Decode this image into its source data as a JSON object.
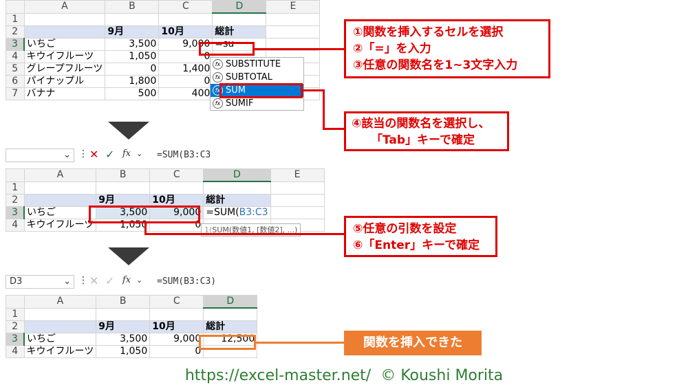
{
  "columns": [
    "A",
    "B",
    "C",
    "D",
    "E"
  ],
  "top_sheet": {
    "rows": [
      "1",
      "2",
      "3",
      "4",
      "5",
      "6",
      "7"
    ],
    "header_row": [
      "",
      "9月",
      "10月",
      "総計"
    ],
    "data": [
      [
        "いちご",
        "3,500",
        "9,000",
        "=su"
      ],
      [
        "キウイフルーツ",
        "1,050",
        "0",
        ""
      ],
      [
        "グレープフルーツ",
        "0",
        "1,400",
        ""
      ],
      [
        "パイナップル",
        "1,800",
        "0",
        ""
      ],
      [
        "バナナ",
        "500",
        "400",
        ""
      ]
    ],
    "autocomplete": [
      "SUBSTITUTE",
      "SUBTOTAL",
      "SUM",
      "SUMIF"
    ],
    "autocomplete_selected": "SUM"
  },
  "mid_fbar": {
    "name_box": "",
    "fx": "fx",
    "formula": "=SUM(B3:C3"
  },
  "mid_sheet": {
    "rows": [
      "1",
      "2",
      "3",
      "4"
    ],
    "header_row": [
      "",
      "9月",
      "10月",
      "総計"
    ],
    "row3": [
      "いちご",
      "3,500",
      "9,000",
      "=SUM(",
      "B3:C3"
    ],
    "row4": [
      "キウイフルーツ",
      "1,050",
      "0"
    ],
    "tooltip": "SUM(数値1, [数値2], ...)",
    "tooltip_prefix": "1("
  },
  "bot_fbar": {
    "name_box": "D3",
    "fx": "fx",
    "formula": "=SUM(B3:C3)"
  },
  "bot_sheet": {
    "rows": [
      "1",
      "2",
      "3",
      "4"
    ],
    "header_row": [
      "",
      "9月",
      "10月",
      "総計"
    ],
    "row3": [
      "いちご",
      "3,500",
      "9,000",
      "12,500"
    ],
    "row4": [
      "キウイフルーツ",
      "1,050",
      "0"
    ]
  },
  "callouts": {
    "c1": [
      "①関数を挿入するセルを選択",
      "②「=」を入力",
      "③任意の関数名を1~3文字入力"
    ],
    "c2": [
      "④該当の関数名を選択し、",
      "「Tab」キーで確定"
    ],
    "c3": [
      "⑤任意の引数を設定",
      "⑥「Enter」キーで確定"
    ],
    "c4": "関数を挿入できた"
  },
  "footer": "https://excel-master.net/  © Koushi Morita",
  "colors": {
    "accent_red": "#e00000",
    "accent_orange": "#ed7d31",
    "excel_green": "#217346",
    "footer_green": "#2e7d32"
  }
}
